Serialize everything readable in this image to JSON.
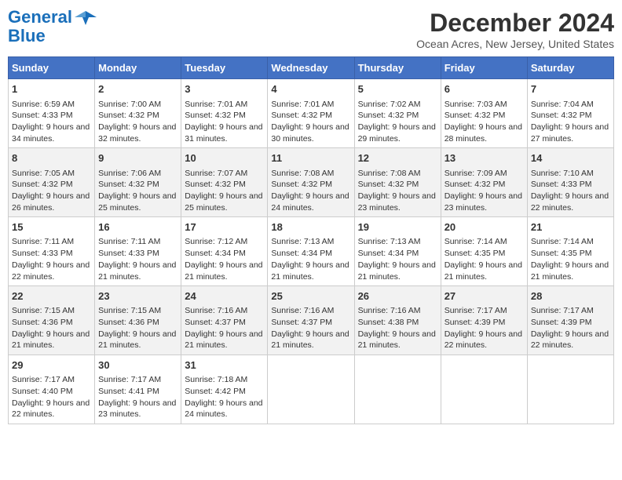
{
  "logo": {
    "line1": "General",
    "line2": "Blue"
  },
  "title": "December 2024",
  "subtitle": "Ocean Acres, New Jersey, United States",
  "days_header": [
    "Sunday",
    "Monday",
    "Tuesday",
    "Wednesday",
    "Thursday",
    "Friday",
    "Saturday"
  ],
  "weeks": [
    [
      {
        "day": "1",
        "sunrise": "6:59 AM",
        "sunset": "4:33 PM",
        "daylight": "9 hours and 34 minutes."
      },
      {
        "day": "2",
        "sunrise": "7:00 AM",
        "sunset": "4:32 PM",
        "daylight": "9 hours and 32 minutes."
      },
      {
        "day": "3",
        "sunrise": "7:01 AM",
        "sunset": "4:32 PM",
        "daylight": "9 hours and 31 minutes."
      },
      {
        "day": "4",
        "sunrise": "7:01 AM",
        "sunset": "4:32 PM",
        "daylight": "9 hours and 30 minutes."
      },
      {
        "day": "5",
        "sunrise": "7:02 AM",
        "sunset": "4:32 PM",
        "daylight": "9 hours and 29 minutes."
      },
      {
        "day": "6",
        "sunrise": "7:03 AM",
        "sunset": "4:32 PM",
        "daylight": "9 hours and 28 minutes."
      },
      {
        "day": "7",
        "sunrise": "7:04 AM",
        "sunset": "4:32 PM",
        "daylight": "9 hours and 27 minutes."
      }
    ],
    [
      {
        "day": "8",
        "sunrise": "7:05 AM",
        "sunset": "4:32 PM",
        "daylight": "9 hours and 26 minutes."
      },
      {
        "day": "9",
        "sunrise": "7:06 AM",
        "sunset": "4:32 PM",
        "daylight": "9 hours and 25 minutes."
      },
      {
        "day": "10",
        "sunrise": "7:07 AM",
        "sunset": "4:32 PM",
        "daylight": "9 hours and 25 minutes."
      },
      {
        "day": "11",
        "sunrise": "7:08 AM",
        "sunset": "4:32 PM",
        "daylight": "9 hours and 24 minutes."
      },
      {
        "day": "12",
        "sunrise": "7:08 AM",
        "sunset": "4:32 PM",
        "daylight": "9 hours and 23 minutes."
      },
      {
        "day": "13",
        "sunrise": "7:09 AM",
        "sunset": "4:32 PM",
        "daylight": "9 hours and 23 minutes."
      },
      {
        "day": "14",
        "sunrise": "7:10 AM",
        "sunset": "4:33 PM",
        "daylight": "9 hours and 22 minutes."
      }
    ],
    [
      {
        "day": "15",
        "sunrise": "7:11 AM",
        "sunset": "4:33 PM",
        "daylight": "9 hours and 22 minutes."
      },
      {
        "day": "16",
        "sunrise": "7:11 AM",
        "sunset": "4:33 PM",
        "daylight": "9 hours and 21 minutes."
      },
      {
        "day": "17",
        "sunrise": "7:12 AM",
        "sunset": "4:34 PM",
        "daylight": "9 hours and 21 minutes."
      },
      {
        "day": "18",
        "sunrise": "7:13 AM",
        "sunset": "4:34 PM",
        "daylight": "9 hours and 21 minutes."
      },
      {
        "day": "19",
        "sunrise": "7:13 AM",
        "sunset": "4:34 PM",
        "daylight": "9 hours and 21 minutes."
      },
      {
        "day": "20",
        "sunrise": "7:14 AM",
        "sunset": "4:35 PM",
        "daylight": "9 hours and 21 minutes."
      },
      {
        "day": "21",
        "sunrise": "7:14 AM",
        "sunset": "4:35 PM",
        "daylight": "9 hours and 21 minutes."
      }
    ],
    [
      {
        "day": "22",
        "sunrise": "7:15 AM",
        "sunset": "4:36 PM",
        "daylight": "9 hours and 21 minutes."
      },
      {
        "day": "23",
        "sunrise": "7:15 AM",
        "sunset": "4:36 PM",
        "daylight": "9 hours and 21 minutes."
      },
      {
        "day": "24",
        "sunrise": "7:16 AM",
        "sunset": "4:37 PM",
        "daylight": "9 hours and 21 minutes."
      },
      {
        "day": "25",
        "sunrise": "7:16 AM",
        "sunset": "4:37 PM",
        "daylight": "9 hours and 21 minutes."
      },
      {
        "day": "26",
        "sunrise": "7:16 AM",
        "sunset": "4:38 PM",
        "daylight": "9 hours and 21 minutes."
      },
      {
        "day": "27",
        "sunrise": "7:17 AM",
        "sunset": "4:39 PM",
        "daylight": "9 hours and 22 minutes."
      },
      {
        "day": "28",
        "sunrise": "7:17 AM",
        "sunset": "4:39 PM",
        "daylight": "9 hours and 22 minutes."
      }
    ],
    [
      {
        "day": "29",
        "sunrise": "7:17 AM",
        "sunset": "4:40 PM",
        "daylight": "9 hours and 22 minutes."
      },
      {
        "day": "30",
        "sunrise": "7:17 AM",
        "sunset": "4:41 PM",
        "daylight": "9 hours and 23 minutes."
      },
      {
        "day": "31",
        "sunrise": "7:18 AM",
        "sunset": "4:42 PM",
        "daylight": "9 hours and 24 minutes."
      },
      null,
      null,
      null,
      null
    ]
  ]
}
